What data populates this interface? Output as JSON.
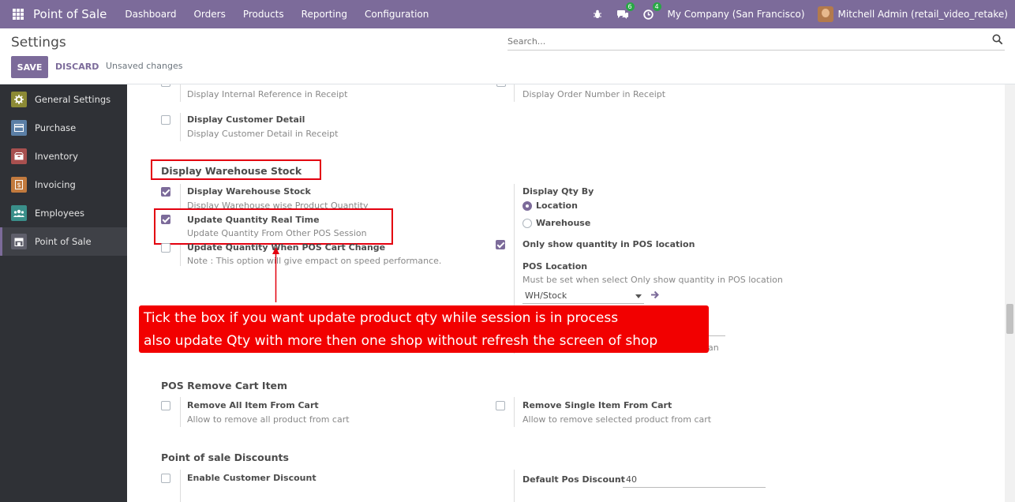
{
  "navbar": {
    "app_name": "Point of Sale",
    "menu": [
      "Dashboard",
      "Orders",
      "Products",
      "Reporting",
      "Configuration"
    ],
    "chat_count": "6",
    "activity_count": "4",
    "company": "My Company (San Francisco)",
    "user": "Mitchell Admin (retail_video_retake)"
  },
  "control_panel": {
    "title": "Settings",
    "search_placeholder": "Search...",
    "save_label": "SAVE",
    "discard_label": "DISCARD",
    "status": "Unsaved changes"
  },
  "sidebar": {
    "items": [
      {
        "label": "General Settings",
        "color": "#8c8a35"
      },
      {
        "label": "Purchase",
        "color": "#5b7fa6"
      },
      {
        "label": "Inventory",
        "color": "#a8504f"
      },
      {
        "label": "Invoicing",
        "color": "#c27a3e"
      },
      {
        "label": "Employees",
        "color": "#3a8f8a"
      },
      {
        "label": "Point of Sale",
        "color": "#5f5f6b"
      }
    ]
  },
  "content": {
    "top_left_desc": "Display Internal Reference in Receipt",
    "top_right_desc": "Display Order Number in Receipt",
    "customer_detail": {
      "label": "Display Customer Detail",
      "desc": "Display Customer Detail in Receipt"
    },
    "warehouse_section": "Display Warehouse Stock",
    "display_stock": {
      "label": "Display Warehouse Stock",
      "desc": "Display Warehouse wise Product Quantity"
    },
    "update_realtime": {
      "label": "Update Quantity Real Time",
      "desc": "Update Quantity From Other POS Session"
    },
    "update_cart": {
      "label": "Update Quantity When POS Cart Change",
      "desc": "Note : This option will give empact on speed performance."
    },
    "qty_by": {
      "label": "Display Qty By",
      "options": [
        "Location",
        "Warehouse"
      ]
    },
    "only_show": {
      "label": "Only show quantity in POS location"
    },
    "pos_location": {
      "label": "POS Location",
      "desc": "Must be set when select Only show quantity in POS location",
      "value": "WH/Stock"
    },
    "hidden_tail": "an",
    "callout": {
      "line1": "Tick the box if you  want  update product qty while session is  in process",
      "line2": "also update Qty  with  more then one  shop  without refresh the screen of shop"
    },
    "remove_section": "POS Remove Cart Item",
    "remove_all": {
      "label": "Remove All Item From Cart",
      "desc": "Allow to remove all product from cart"
    },
    "remove_single": {
      "label": "Remove Single Item From Cart",
      "desc": "Allow to remove selected product from cart"
    },
    "discount_section": "Point of sale Discounts",
    "customer_discount": {
      "label": "Enable Customer Discount"
    },
    "default_discount": {
      "label": "Default Pos Discount",
      "sep": ":",
      "value": "40"
    }
  }
}
